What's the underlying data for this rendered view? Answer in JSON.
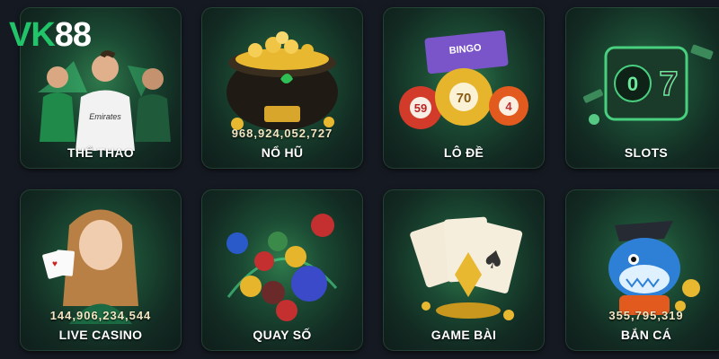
{
  "brand": {
    "logo_vk": "VK",
    "logo_num": "88"
  },
  "tiles": [
    {
      "label": "THỂ THAO",
      "jackpot": ""
    },
    {
      "label": "NỔ HŨ",
      "jackpot": "968,924,052,727"
    },
    {
      "label": "LÔ ĐỀ",
      "jackpot": ""
    },
    {
      "label": "SLOTS",
      "jackpot": ""
    },
    {
      "label": "LIVE CASINO",
      "jackpot": "144,906,234,544"
    },
    {
      "label": "QUAY SỐ",
      "jackpot": ""
    },
    {
      "label": "GAME BÀI",
      "jackpot": ""
    },
    {
      "label": "BẮN CÁ",
      "jackpot": "355,795,319"
    }
  ],
  "lotto_balls": {
    "left": "59",
    "center": "70",
    "right": "4"
  },
  "bingo_card_text": "BINGO",
  "colors": {
    "accent": "#22c46a",
    "background": "#151a22",
    "gold": "#e8b830"
  }
}
